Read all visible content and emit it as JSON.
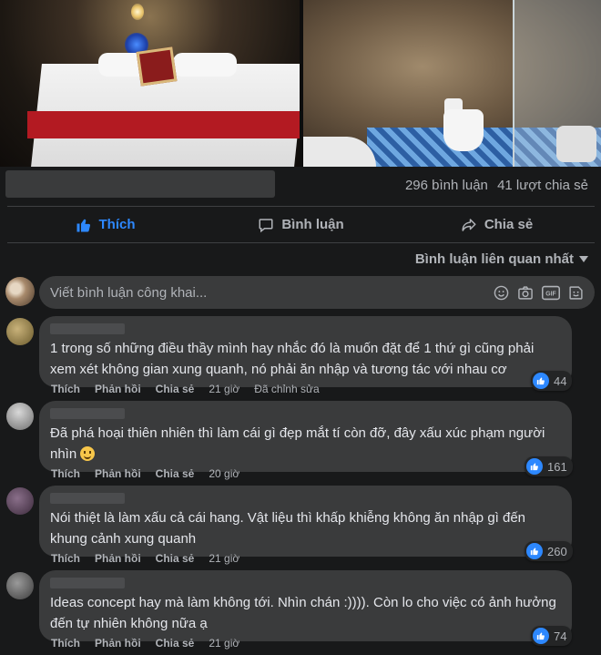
{
  "post": {
    "comment_count": "296 bình luận",
    "share_count": "41 lượt chia sẻ"
  },
  "actions": {
    "like": "Thích",
    "comment": "Bình luận",
    "share": "Chia sẻ"
  },
  "sort_label": "Bình luận liên quan nhất",
  "composer": {
    "placeholder": "Viết bình luận công khai..."
  },
  "comment_actions": {
    "like": "Thích",
    "reply": "Phản hồi",
    "share": "Chia sẻ"
  },
  "comments": [
    {
      "text": "1 trong số những điều thầy mình hay nhắc đó là muốn đặt để 1 thứ gì cũng phải xem xét không gian xung quanh, nó phải ăn nhập và tương tác với nhau cơ",
      "time": "21 giờ",
      "edited": "Đã chỉnh sửa",
      "reactions": "44"
    },
    {
      "text": "Đã phá hoại thiên nhiên thì làm cái gì đẹp mắt tí còn đỡ, đây xấu xúc phạm người nhìn",
      "time": "20 giờ",
      "reactions": "161"
    },
    {
      "text": "Nói thiệt là làm xấu cả cái hang. Vật liệu thì khấp khiễng không ăn nhập gì đến khung cảnh xung quanh",
      "time": "21 giờ",
      "reactions": "260"
    },
    {
      "text": "Ideas concept hay mà làm không tới. Nhìn chán :)))). Còn lo cho việc có ảnh hưởng đến tự nhiên không nữa ạ",
      "time": "21 giờ",
      "reactions": "74"
    }
  ],
  "colors": {
    "background": "#18191a",
    "bubble": "#3a3b3c",
    "accent": "#2d88ff",
    "secondary_text": "#b0b3b8"
  }
}
